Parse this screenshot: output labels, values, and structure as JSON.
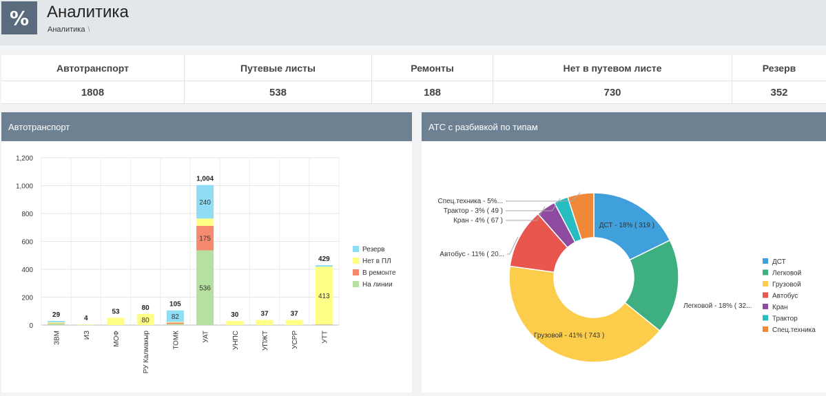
{
  "header": {
    "logo_glyph": "%",
    "title": "Аналитика",
    "breadcrumb": "Аналитика",
    "breadcrumb_sep": "\\"
  },
  "stats": [
    {
      "label": "Автотранспорт",
      "value": "1808"
    },
    {
      "label": "Путевые листы",
      "value": "538"
    },
    {
      "label": "Ремонты",
      "value": "188"
    },
    {
      "label": "Нет в путевом листе",
      "value": "730"
    },
    {
      "label": "Резерв",
      "value": "352"
    }
  ],
  "panels": {
    "left_title": "Автотранспорт",
    "right_title": "АТС с разбивкой по типам"
  },
  "colors": {
    "header_bg": "#e4e7ea",
    "panel_head": "#6d8193",
    "logo_bg": "#5a6b7d"
  },
  "chart_data": [
    {
      "type": "bar",
      "stacked": true,
      "categories": [
        "ЗВМ",
        "ИЗ",
        "МОФ",
        "РУ Калмакыр",
        "ТОМК",
        "УАТ",
        "УНПС",
        "УПЖТ",
        "УСРР",
        "УТТ"
      ],
      "series": [
        {
          "name": "На линии",
          "color": "#b5e0a2",
          "values": [
            10,
            1,
            0,
            0,
            8,
            536,
            0,
            0,
            0,
            4
          ]
        },
        {
          "name": "В ремонте",
          "color": "#f58a6e",
          "values": [
            2,
            0,
            0,
            0,
            10,
            175,
            0,
            0,
            0,
            2
          ]
        },
        {
          "name": "Нет в ПЛ",
          "color": "#ffff88",
          "values": [
            7,
            3,
            53,
            80,
            5,
            53,
            30,
            37,
            37,
            413
          ]
        },
        {
          "name": "Резерв",
          "color": "#8fdcf5",
          "values": [
            10,
            0,
            0,
            0,
            82,
            240,
            0,
            0,
            0,
            10
          ]
        }
      ],
      "totals": [
        "29",
        "4",
        "53",
        "80",
        "105",
        "1,004",
        "30",
        "37",
        "37",
        "429"
      ],
      "segment_labels": [
        {
          "category": "РУ Калмакыр",
          "series": "Нет в ПЛ",
          "text": "80"
        },
        {
          "category": "ТОМК",
          "series": "Резерв",
          "text": "82"
        },
        {
          "category": "УАТ",
          "series": "На линии",
          "text": "536"
        },
        {
          "category": "УАТ",
          "series": "В ремонте",
          "text": "175"
        },
        {
          "category": "УАТ",
          "series": "Резерв",
          "text": "240"
        },
        {
          "category": "УТТ",
          "series": "Нет в ПЛ",
          "text": "413"
        }
      ],
      "ylim": [
        0,
        1200
      ],
      "yticks": [
        "0",
        "200",
        "400",
        "600",
        "800",
        "1,000",
        "1,200"
      ],
      "legend_order": [
        "Резерв",
        "Нет в ПЛ",
        "В ремонте",
        "На линии"
      ],
      "legend_position": "right",
      "grid": true
    },
    {
      "type": "pie",
      "donut": true,
      "slices": [
        {
          "name": "ДСТ",
          "value": 319,
          "percent": 18,
          "color": "#3fa0dc",
          "label": "ДСТ - 18% ( 319 )"
        },
        {
          "name": "Легковой",
          "value": 325,
          "percent": 18,
          "color": "#3daf81",
          "label": "Легковой - 18% ( 32..."
        },
        {
          "name": "Грузовой",
          "value": 743,
          "percent": 41,
          "color": "#fbcd4b",
          "label": "Грузовой - 41% ( 743 )"
        },
        {
          "name": "Автобус",
          "value": 205,
          "percent": 11,
          "color": "#e8564e",
          "label": "Автобус - 11% ( 20..."
        },
        {
          "name": "Кран",
          "value": 67,
          "percent": 4,
          "color": "#8e4ba0",
          "label": "Кран - 4% ( 67 )"
        },
        {
          "name": "Трактор",
          "value": 49,
          "percent": 3,
          "color": "#27bdc0",
          "label": "Трактор - 3% ( 49 )"
        },
        {
          "name": "Спец.техника",
          "value": 90,
          "percent": 5,
          "color": "#f0883a",
          "label": "Спец.техника - 5%..."
        }
      ],
      "legend_position": "right"
    }
  ]
}
